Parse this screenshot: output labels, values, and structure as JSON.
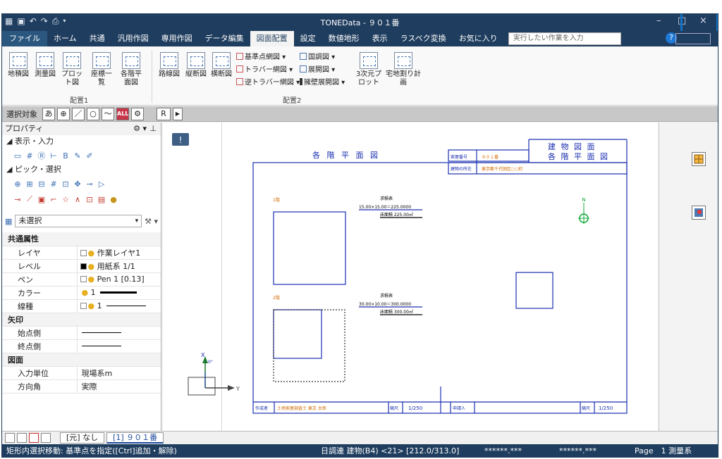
{
  "window": {
    "title": "TONEData - ９０１番",
    "min_glyph": "–",
    "max_glyph": "□",
    "close_glyph": "×"
  },
  "menu": {
    "tabs": [
      "ファイル",
      "ホーム",
      "共通",
      "汎用作図",
      "専用作図",
      "データ編集",
      "図面配置",
      "設定",
      "数値地形",
      "表示",
      "ラスベク変換",
      "お気に入り"
    ],
    "active_tab": "図面配置",
    "search_placeholder": "実行したい作業を入力",
    "help": "?"
  },
  "ribbon": {
    "group1": {
      "label": "配置1",
      "buttons": [
        "地積図",
        "測量図",
        "プロット図",
        "座標一覧",
        "各階平面図"
      ]
    },
    "group2": {
      "label": "配置2",
      "buttons": [
        "路線図",
        "縦断図",
        "横断図"
      ],
      "small": [
        "基準点網図",
        "トラバー網図",
        "逆トラバー網図",
        "国調図",
        "展開図",
        "擁壁展開図"
      ],
      "more": [
        "3次元プロット",
        "宅地割り計画"
      ]
    }
  },
  "selection": {
    "label": "選択対象",
    "buttons": [
      "あ",
      "⊕",
      "／",
      "○",
      "〜",
      "ALL",
      "⚙"
    ],
    "r_button": "R"
  },
  "property": {
    "title": "プロパティ",
    "sections": {
      "display": "表示・入力",
      "pick": "ピック・選択"
    },
    "dropdown": "未選択",
    "groups": [
      {
        "name": "共通属性",
        "rows": [
          {
            "key": "レイヤ",
            "value": "作業レイヤ1"
          },
          {
            "key": "レベル",
            "value": "用紙系 1/1"
          },
          {
            "key": "ペン",
            "value": "Pen 1 [0.13]"
          },
          {
            "key": "カラー",
            "value": "1"
          },
          {
            "key": "線種",
            "value": "1"
          }
        ]
      },
      {
        "name": "矢印",
        "rows": [
          {
            "key": "始点側",
            "value": ""
          },
          {
            "key": "終点側",
            "value": ""
          }
        ]
      },
      {
        "name": "図面",
        "rows": [
          {
            "key": "入力単位",
            "value": "現場系m"
          },
          {
            "key": "方向角",
            "value": "実際"
          }
        ]
      }
    ]
  },
  "layout_tabs": [
    "[元] なし",
    "[1] ９０１番"
  ],
  "drawing": {
    "header_title": "各 階 平 面 図",
    "header_right_top": "建 物 図 面",
    "header_right_bottom": "各 階 平 面 図",
    "field_number_label": "家屋番号",
    "field_number_value": "９０１番",
    "field_location_label": "建物の所在",
    "field_location_value": "東京都千代田区○○町",
    "floor1_label": "1階",
    "floor1_area_title": "求積表",
    "floor1_formula": "15.00×15.00＝225.0000",
    "floor1_total": "床面積 225.00㎡",
    "floor2_label": "2階",
    "floor2_area_title": "求積表",
    "floor2_formula": "30.00×10.00＝300.0000",
    "floor2_total": "床面積 300.00㎡",
    "north": "N",
    "axis_x": "X",
    "axis_y": "Y",
    "axis_angle": "0°",
    "footer_author_label": "作成者",
    "footer_author_value": "土地家屋調査士 東京 太郎",
    "footer_scale_label": "縮尺",
    "footer_scale_value": "1/250",
    "footer_applicant_label": "申請人",
    "footer_scale2_label": "縮尺",
    "footer_scale2_value": "1/250"
  },
  "status": {
    "message": "矩形内選択移動: 基準点を指定([Ctrl]追加・解除)",
    "info": "日調連 建物(B4) <21> [212.0/313.0]",
    "coord1": "******.***",
    "coord2": "******.***",
    "page": "Page　1 測量系"
  },
  "colors": {
    "titlebar": "#1f3d5e",
    "accent": "#1473c4",
    "drawing_blue": "#1a2fb0",
    "drawing_orange": "#d06a00"
  }
}
